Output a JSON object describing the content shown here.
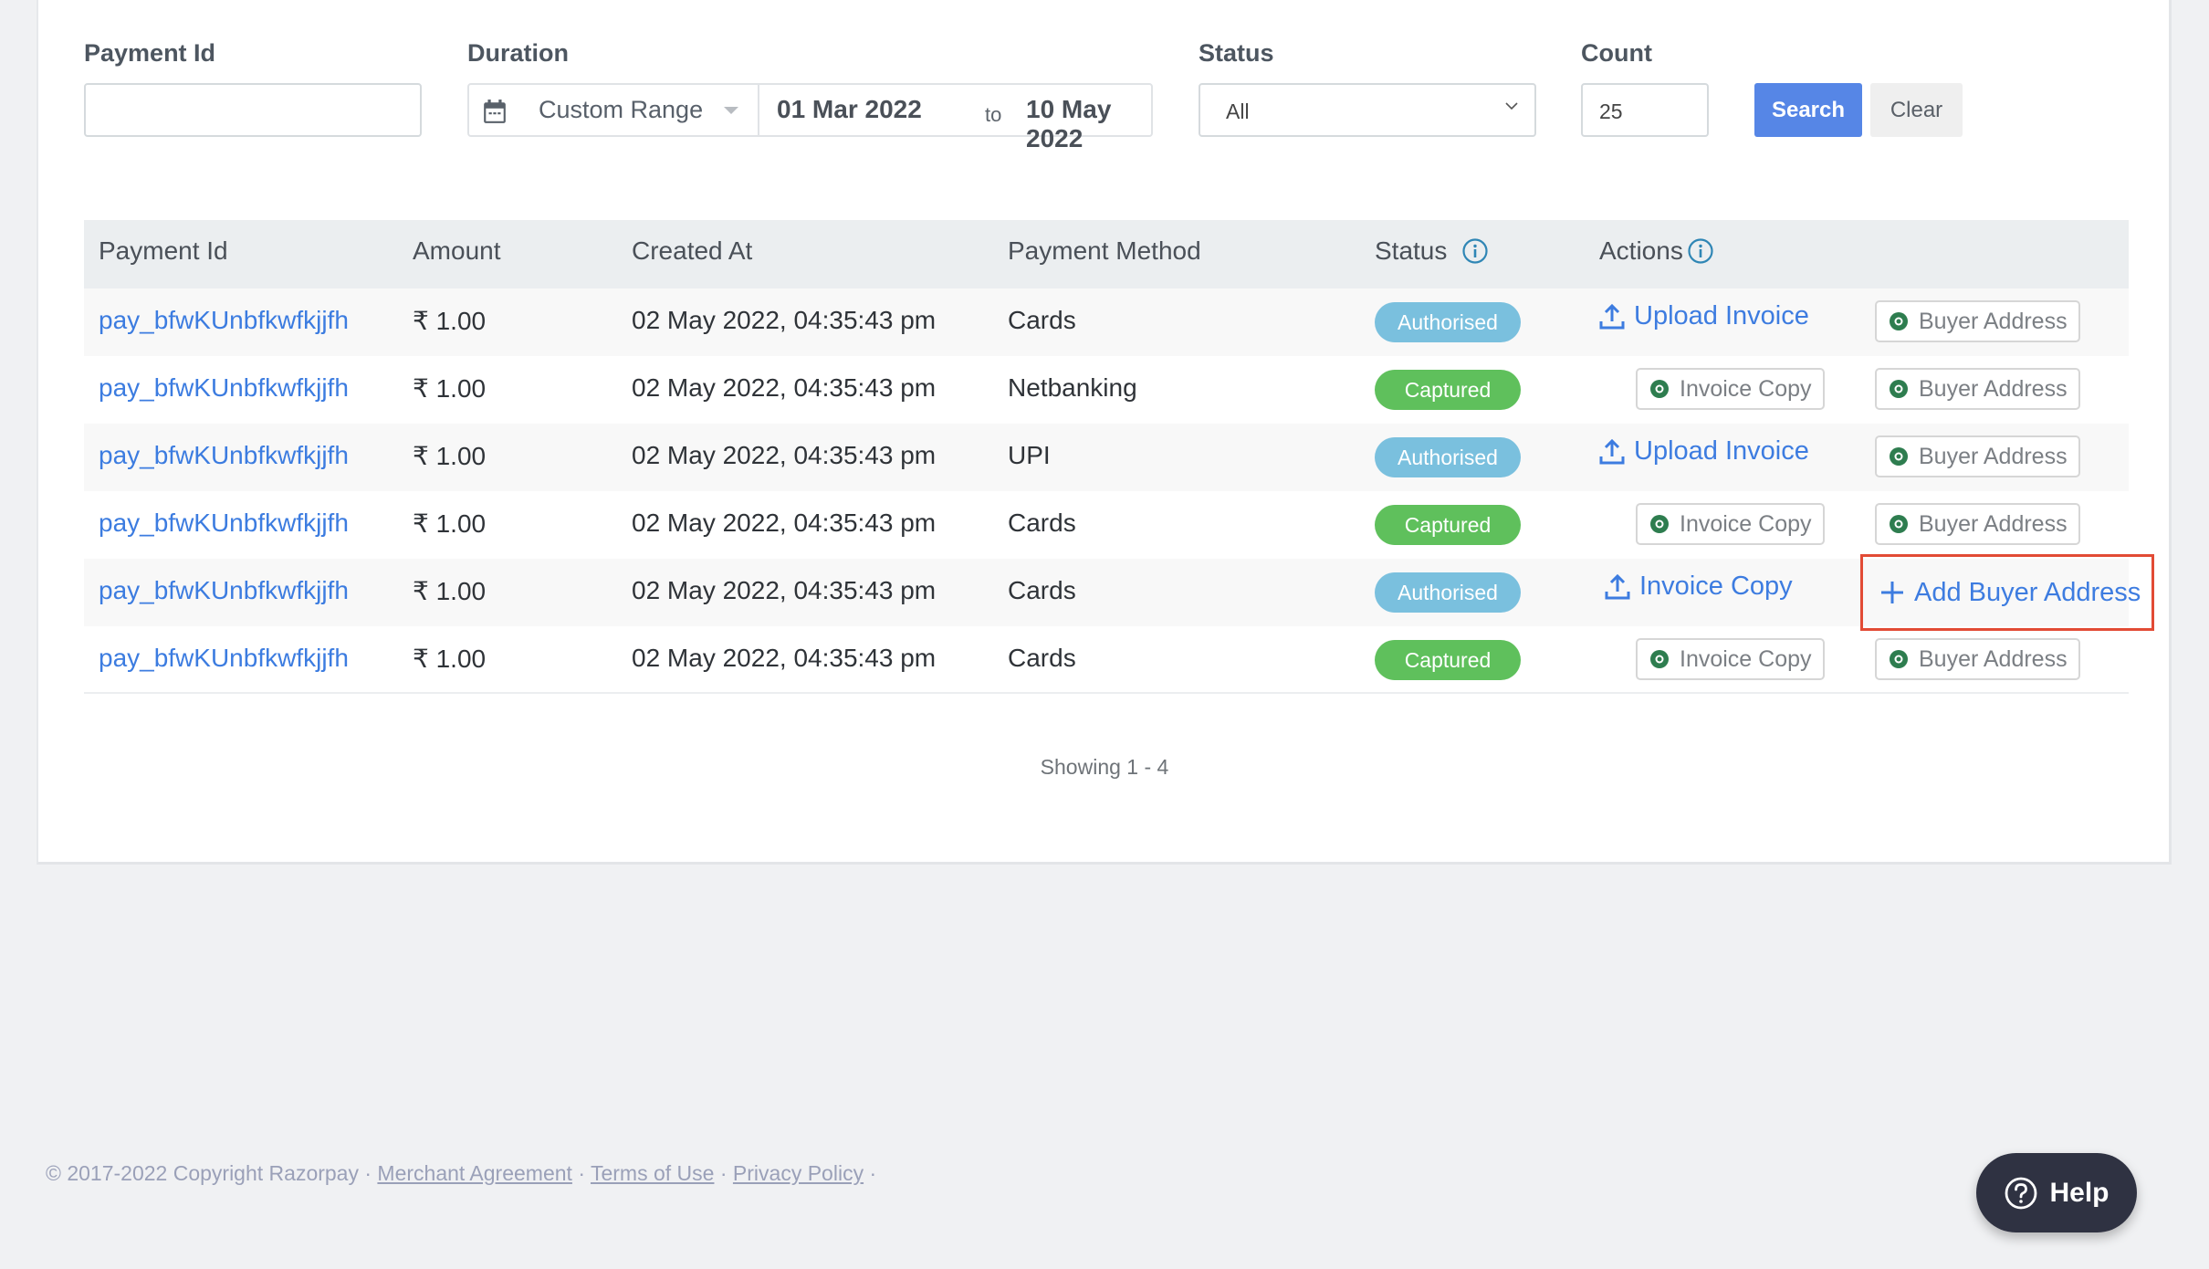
{
  "filters": {
    "payment_id": {
      "label": "Payment Id",
      "value": "",
      "placeholder": ""
    },
    "duration": {
      "label": "Duration",
      "preset": "Custom Range",
      "from": "01 Mar 2022",
      "to_label": "to",
      "to": "10 May 2022"
    },
    "status": {
      "label": "Status",
      "selected": "All"
    },
    "count": {
      "label": "Count",
      "value": "25"
    },
    "search_label": "Search",
    "clear_label": "Clear"
  },
  "table": {
    "columns": [
      "Payment Id",
      "Amount",
      "Created At",
      "Payment Method",
      "Status",
      "Actions"
    ],
    "rows": [
      {
        "payment_id": "pay_bfwKUnbfkwfkjjfh",
        "amount": "₹ 1.00",
        "created_at": "02 May 2022, 04:35:43 pm",
        "method": "Cards",
        "status": "Authorised",
        "action1": "Upload Invoice",
        "action2": "Buyer Address"
      },
      {
        "payment_id": "pay_bfwKUnbfkwfkjjfh",
        "amount": "₹ 1.00",
        "created_at": "02 May 2022, 04:35:43 pm",
        "method": "Netbanking",
        "status": "Captured",
        "action1": "Invoice Copy",
        "action2": "Buyer Address"
      },
      {
        "payment_id": "pay_bfwKUnbfkwfkjjfh",
        "amount": "₹ 1.00",
        "created_at": "02 May 2022, 04:35:43 pm",
        "method": "UPI",
        "status": "Authorised",
        "action1": "Upload Invoice",
        "action2": "Buyer Address"
      },
      {
        "payment_id": "pay_bfwKUnbfkwfkjjfh",
        "amount": "₹ 1.00",
        "created_at": "02 May 2022, 04:35:43 pm",
        "method": "Cards",
        "status": "Captured",
        "action1": "Invoice Copy",
        "action2": "Buyer Address"
      },
      {
        "payment_id": "pay_bfwKUnbfkwfkjjfh",
        "amount": "₹ 1.00",
        "created_at": "02 May 2022, 04:35:43 pm",
        "method": "Cards",
        "status": "Authorised",
        "action1": "Invoice Copy",
        "action2": "Add Buyer Address"
      },
      {
        "payment_id": "pay_bfwKUnbfkwfkjjfh",
        "amount": "₹ 1.00",
        "created_at": "02 May 2022, 04:35:43 pm",
        "method": "Cards",
        "status": "Captured",
        "action1": "Invoice Copy",
        "action2": "Buyer Address"
      }
    ]
  },
  "pagination": {
    "showing": "Showing 1 - 4"
  },
  "footer": {
    "copyright": "© 2017-2022 Copyright Razorpay ·",
    "links": [
      "Merchant Agreement",
      "Terms of Use",
      "Privacy Policy"
    ],
    "sep": "·"
  },
  "help": {
    "label": "Help"
  },
  "colors": {
    "accent": "#5686e6",
    "link": "#3d7ce0",
    "authorised": "#7ac0de",
    "captured": "#5fc05c",
    "eye_icon": "#2e7d4f",
    "highlight_border": "#e24b35"
  }
}
